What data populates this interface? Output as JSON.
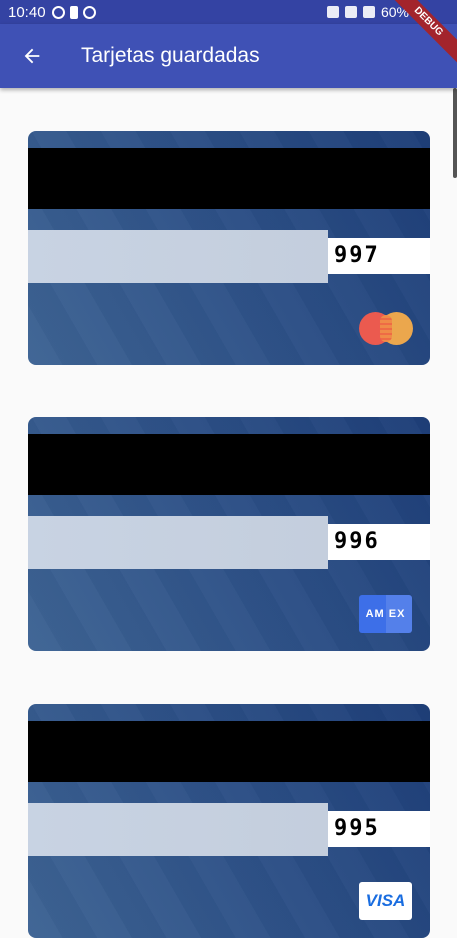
{
  "status_bar": {
    "time": "10:40",
    "battery": "60%"
  },
  "app_bar": {
    "title": "Tarjetas guardadas"
  },
  "debug_banner": "DEBUG",
  "cards": [
    {
      "cvv": "997",
      "brand": "mastercard"
    },
    {
      "cvv": "996",
      "brand": "amex",
      "brand_label": "AM EX"
    },
    {
      "cvv": "995",
      "brand": "visa",
      "brand_label": "VISA"
    }
  ]
}
